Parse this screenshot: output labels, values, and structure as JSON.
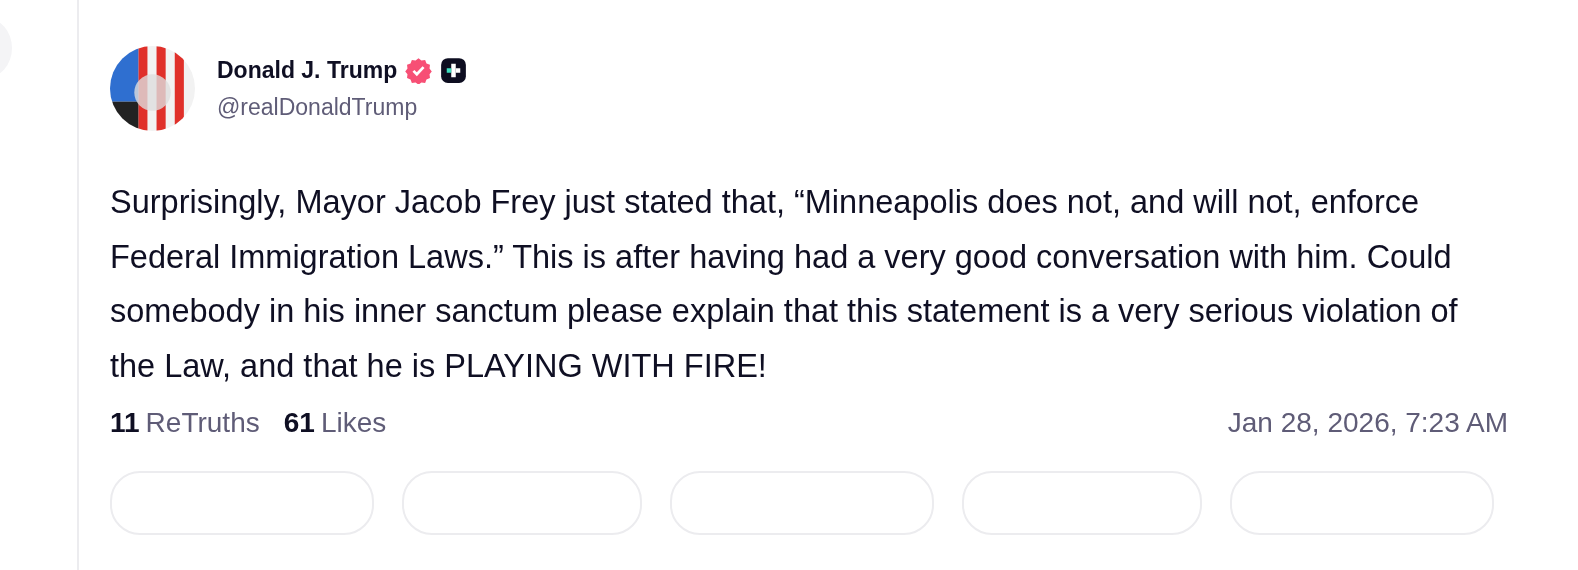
{
  "post": {
    "author": {
      "name": "Donald J. Trump",
      "verified": true,
      "plus_badge": true,
      "handle": "@realDonaldTrump"
    },
    "text": "Surprisingly, Mayor Jacob Frey just stated that, “Minneapolis does not, and will not, enforce Federal Immigration Laws.” This is after having had a very good conversation with him. Could somebody in his inner sanctum please explain that this statement is a very serious violation of the Law, and that he is PLAYING WITH FIRE!",
    "stats": [
      {
        "count": "11",
        "label": "ReTruths"
      },
      {
        "count": "61",
        "label": "Likes"
      }
    ],
    "timestamp": "Jan 28, 2026, 7:23 AM"
  }
}
